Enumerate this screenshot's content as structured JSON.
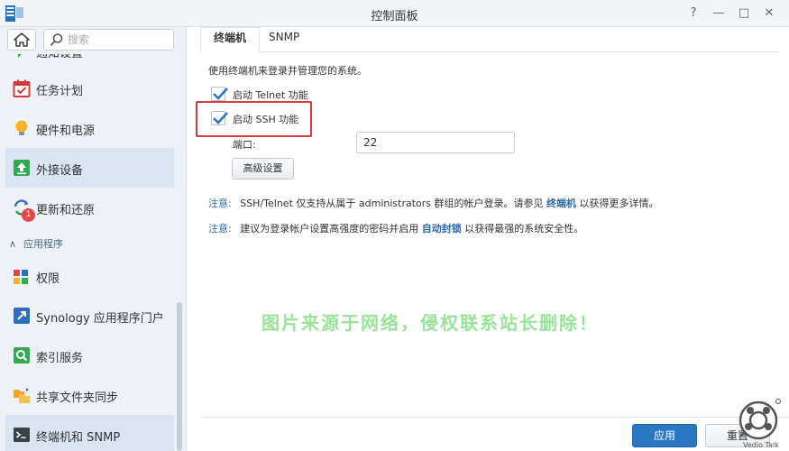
{
  "window": {
    "title": "控制面板",
    "buttons": {
      "help": "?",
      "minimize": "—",
      "maximize": "□",
      "close": "✕"
    }
  },
  "sidebar": {
    "search_placeholder": "搜索",
    "items": [
      {
        "label": "通知设置",
        "icon": "notification-icon"
      },
      {
        "label": "任务计划",
        "icon": "calendar-check-icon"
      },
      {
        "label": "硬件和电源",
        "icon": "lightbulb-icon"
      },
      {
        "label": "外接设备",
        "icon": "upload-icon"
      },
      {
        "label": "更新和还原",
        "icon": "refresh-icon",
        "badge": "1"
      },
      {
        "label": "权限",
        "icon": "permissions-icon"
      },
      {
        "label": "Synology 应用程序门户",
        "icon": "portal-icon"
      },
      {
        "label": "索引服务",
        "icon": "index-search-icon"
      },
      {
        "label": "共享文件夹同步",
        "icon": "folder-sync-icon"
      },
      {
        "label": "终端机和 SNMP",
        "icon": "terminal-icon"
      }
    ],
    "section_header": "应用程序",
    "active_item": "终端机和 SNMP"
  },
  "tabs": [
    {
      "label": "终端机",
      "active": true
    },
    {
      "label": "SNMP",
      "active": false
    }
  ],
  "main": {
    "description": "使用终端机来登录并管理您的系统。",
    "telnet": {
      "label": "启动 Telnet 功能",
      "checked": true
    },
    "ssh": {
      "label": "启动 SSH 功能",
      "checked": true
    },
    "port_label": "端口:",
    "port_value": "22",
    "advanced_button": "高级设置",
    "note1": {
      "prefix": "注意:",
      "before": "SSH/Telnet 仅支持从属于 administrators 群组的帐户登录。请参见",
      "link": "终端机",
      "after": "以获得更多详情。"
    },
    "note2": {
      "prefix": "注意:",
      "before": "建议为登录帐户设置高强度的密码并启用",
      "link": "自动封锁",
      "after": "以获得最强的系统安全性。"
    }
  },
  "watermark": "图片来源于网络，侵权联系站长删除！",
  "footer": {
    "apply": "应用",
    "reset": "重置"
  },
  "logo_text": "Vedio Talk",
  "colors": {
    "accent": "#2a77c4",
    "highlight": "#d63a3a",
    "link": "#2d6aa8",
    "watermark": "#8fe08f"
  }
}
